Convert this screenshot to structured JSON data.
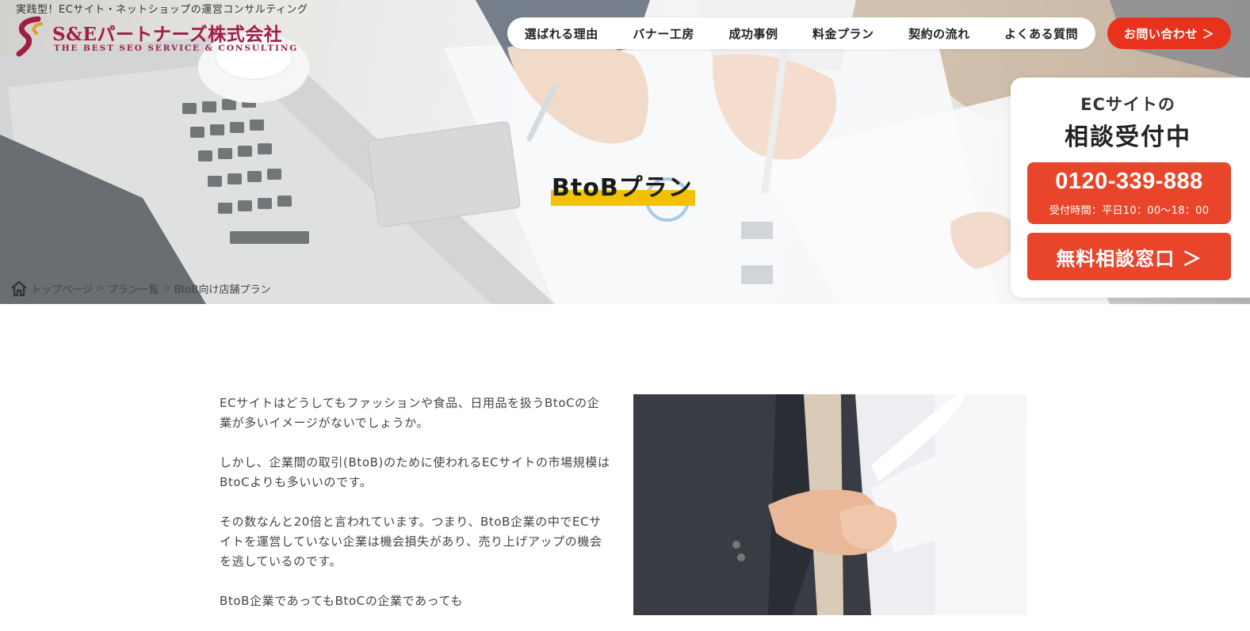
{
  "header": {
    "tagline": "実践型！ECサイト・ネットショップの運営コンサルティング",
    "logo_name": "S&Eパートナーズ株式会社",
    "logo_sub": "THE BEST SEO SERVICE & CONSULTING",
    "contact_label": "お問い合わせ ＞"
  },
  "nav": [
    {
      "label": "選ばれる理由"
    },
    {
      "label": "バナー工房"
    },
    {
      "label": "成功事例"
    },
    {
      "label": "料金プラン"
    },
    {
      "label": "契約の流れ"
    },
    {
      "label": "よくある質問"
    }
  ],
  "hero": {
    "title": "BtoBプラン"
  },
  "breadcrumb": {
    "items": [
      "トップページ",
      "プラン一覧",
      "BtoB向け店舗プラン"
    ],
    "separator": ">"
  },
  "consult": {
    "line1": "ECサイトの",
    "line2": "相談受付中",
    "phone": "0120-339-888",
    "hours": "受付時間：平日10：00〜18：00",
    "button": "無料相談窓口 ＞"
  },
  "content": {
    "paragraphs": [
      [
        "ECサイトはどうしてもファッションや食品、日用品を扱うBtoCの企",
        "業が多いイメージがないでしょうか。"
      ],
      [
        "しかし、企業間の取引(BtoB)のために使われるECサイトの市場規模は",
        "BtoCよりも多いいのです。"
      ],
      [
        "その数なんと20倍と言われています。つまり、BtoB企業の中でECサ",
        "イトを運営していない企業は機会損失があり、売り上げアップの機会",
        "を逃しているのです。"
      ],
      [
        "BtoB企業であってもBtoCの企業であっても"
      ]
    ]
  },
  "colors": {
    "accent": "#e8321c",
    "button": "#e8452b",
    "brand": "#a01d46",
    "highlight": "#f2c200"
  }
}
